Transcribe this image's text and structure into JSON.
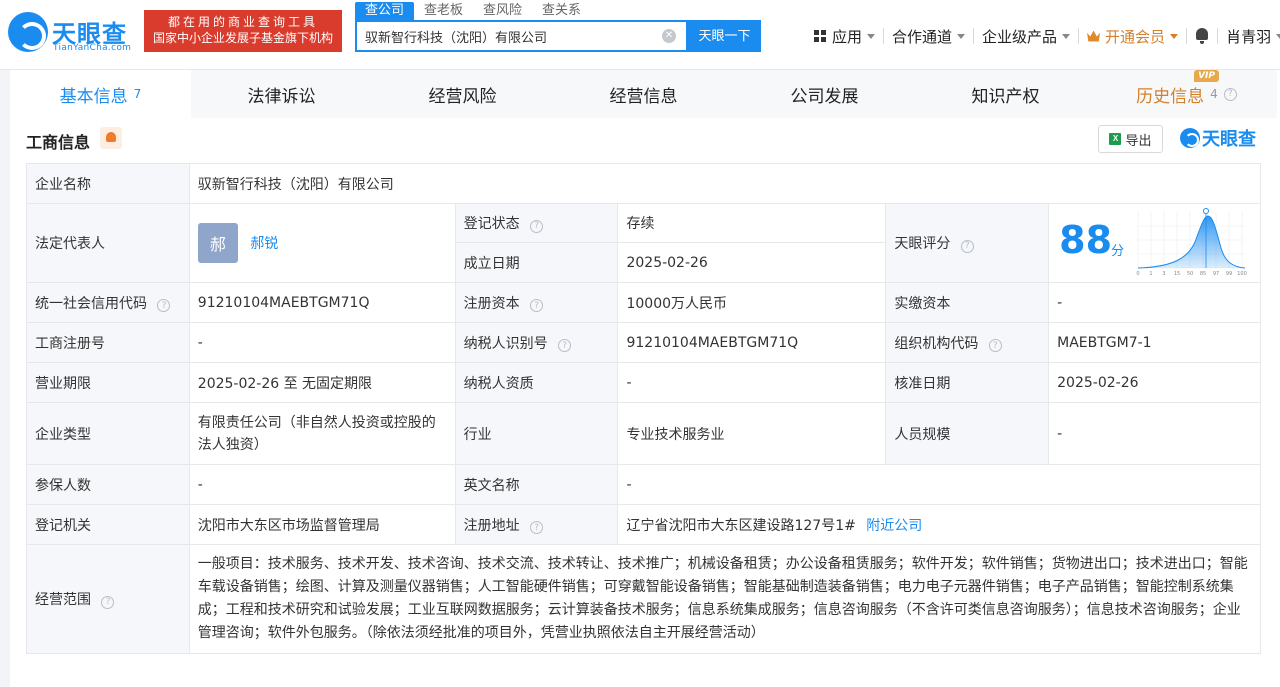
{
  "header": {
    "logo_text": "天眼查",
    "logo_sub": "TianYanCha.com",
    "banner_line1": "都在用的商业查询工具",
    "banner_line2": "国家中小企业发展子基金旗下机构",
    "search_tabs": [
      "查公司",
      "查老板",
      "查风险",
      "查关系"
    ],
    "search_value": "驭新智行科技（沈阳）有限公司",
    "search_button": "天眼一下",
    "nav": {
      "apps": "应用",
      "channel": "合作通道",
      "enterprise": "企业级产品",
      "vip": "开通会员",
      "user": "肖青羽"
    }
  },
  "tabs": [
    {
      "label": "基本信息",
      "count": "7"
    },
    {
      "label": "法律诉讼",
      "count": ""
    },
    {
      "label": "经营风险",
      "count": ""
    },
    {
      "label": "经营信息",
      "count": ""
    },
    {
      "label": "公司发展",
      "count": ""
    },
    {
      "label": "知识产权",
      "count": ""
    },
    {
      "label": "历史信息",
      "count": "4",
      "tag": "VIP"
    }
  ],
  "section": {
    "title": "工商信息",
    "export": "导出",
    "brand": "天眼查"
  },
  "info": {
    "company_name_label": "企业名称",
    "company_name": "驭新智行科技（沈阳）有限公司",
    "legal_rep_label": "法定代表人",
    "legal_rep_avatar": "郝",
    "legal_rep": "郝锐",
    "reg_status_label": "登记状态",
    "reg_status": "存续",
    "founded_label": "成立日期",
    "founded": "2025-02-26",
    "score_label": "天眼评分",
    "score": "88",
    "score_unit": "分",
    "score_axis": [
      "0",
      "1",
      "3",
      "15",
      "50",
      "85",
      "97",
      "99",
      "100"
    ],
    "credit_code_label": "统一社会信用代码",
    "credit_code": "91210104MAEBTGM71Q",
    "reg_capital_label": "注册资本",
    "reg_capital": "10000万人民币",
    "paid_capital_label": "实缴资本",
    "paid_capital": "-",
    "reg_no_label": "工商注册号",
    "reg_no": "-",
    "taxpayer_id_label": "纳税人识别号",
    "taxpayer_id": "91210104MAEBTGM71Q",
    "org_code_label": "组织机构代码",
    "org_code": "MAEBTGM7-1",
    "term_label": "营业期限",
    "term": "2025-02-26 至 无固定期限",
    "taxpayer_qual_label": "纳税人资质",
    "taxpayer_qual": "-",
    "approve_date_label": "核准日期",
    "approve_date": "2025-02-26",
    "type_label": "企业类型",
    "type": "有限责任公司（非自然人投资或控股的法人独资）",
    "industry_label": "行业",
    "industry": "专业技术服务业",
    "staff_size_label": "人员规模",
    "staff_size": "-",
    "insured_label": "参保人数",
    "insured": "-",
    "en_name_label": "英文名称",
    "en_name": "-",
    "authority_label": "登记机关",
    "authority": "沈阳市大东区市场监督管理局",
    "address_label": "注册地址",
    "address": "辽宁省沈阳市大东区建设路127号1#",
    "nearby": "附近公司",
    "scope_label": "经营范围",
    "scope": "一般项目：技术服务、技术开发、技术咨询、技术交流、技术转让、技术推广；机械设备租赁；办公设备租赁服务；软件开发；软件销售；货物进出口；技术进出口；智能车载设备销售；绘图、计算及测量仪器销售；人工智能硬件销售；可穿戴智能设备销售；智能基础制造装备销售；电力电子元器件销售；电子产品销售；智能控制系统集成；工程和技术研究和试验发展；工业互联网数据服务；云计算装备技术服务；信息系统集成服务；信息咨询服务（不含许可类信息咨询服务）；信息技术咨询服务；企业管理咨询；软件外包服务。（除依法须经批准的项目外，凭营业执照依法自主开展经营活动）"
  },
  "colors": {
    "brand_blue": "#1a8cf0",
    "banner_red": "#d93b2d",
    "status_green": "#23a55a",
    "vip_orange": "#d4802a"
  }
}
